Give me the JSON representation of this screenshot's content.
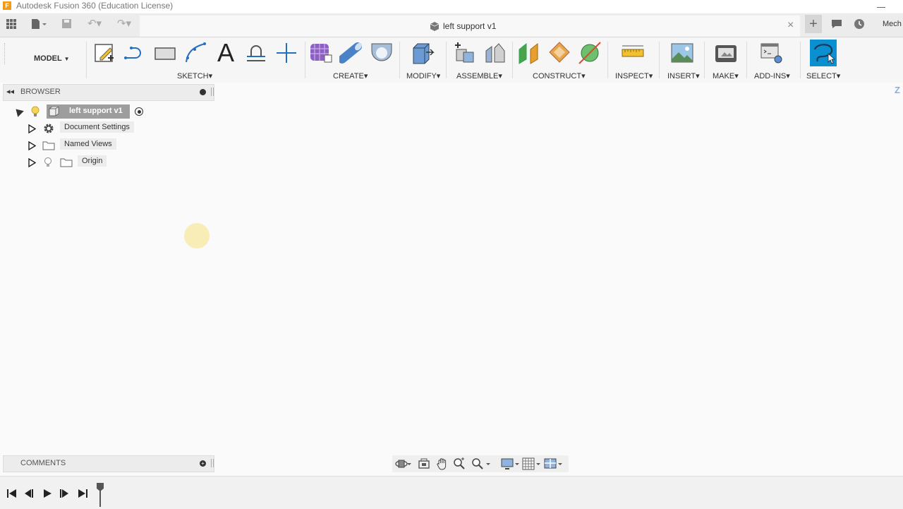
{
  "window": {
    "title": "Autodesk Fusion 360 (Education License)"
  },
  "tabbar": {
    "tab_title": "left support v1",
    "account": "Mech"
  },
  "workspace": {
    "label": "MODEL"
  },
  "groups": {
    "sketch": "SKETCH",
    "create": "CREATE",
    "modify": "MODIFY",
    "assemble": "ASSEMBLE",
    "construct": "CONSTRUCT",
    "inspect": "INSPECT",
    "insert": "INSERT",
    "make": "MAKE",
    "addins": "ADD-INS",
    "select": "SELECT"
  },
  "browser": {
    "header": "BROWSER",
    "root": "left support v1",
    "items": [
      {
        "label": "Document Settings",
        "icon": "gear-icon"
      },
      {
        "label": "Named Views",
        "icon": "folder-icon"
      },
      {
        "label": "Origin",
        "icon": "folder-icon"
      }
    ]
  },
  "comments": {
    "header": "COMMENTS"
  },
  "viewcube": {
    "label": "Z"
  },
  "colors": {
    "accent": "#0696d7",
    "select_active": "#0a8fd0",
    "cursor_highlight": "#f7e7a0"
  }
}
